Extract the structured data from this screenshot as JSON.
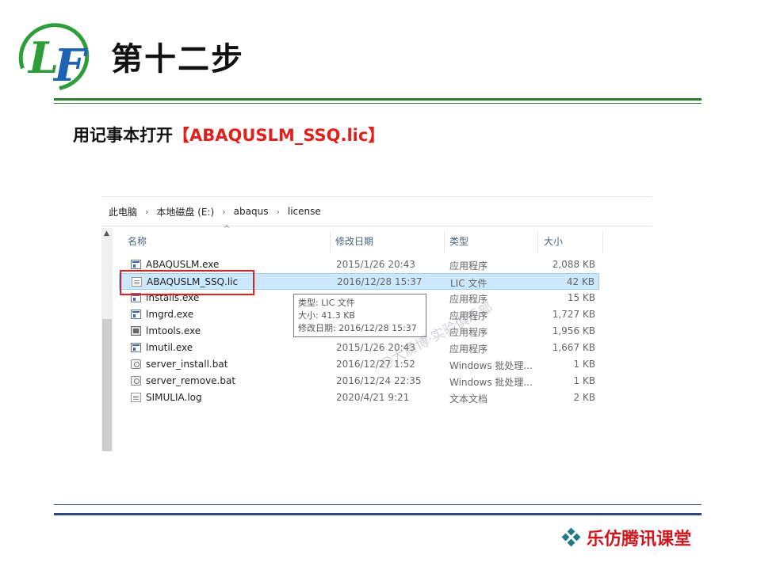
{
  "logo": {
    "text": "LF",
    "colors": {
      "L": "#2e9e3a",
      "F": "#1e62b4",
      "ring": "#2e9e3a"
    }
  },
  "slide": {
    "title": "第十二步",
    "instruction_prefix": "用记事本打开",
    "instruction_highlight": "【ABAQUSLM_SSQ.lic】"
  },
  "explorer": {
    "breadcrumb": [
      "此电脑",
      "本地磁盘 (E:)",
      "abaqus",
      "license"
    ],
    "columns": {
      "name": "名称",
      "date": "修改日期",
      "type": "类型",
      "size": "大小"
    },
    "files": [
      {
        "name": "ABAQUSLM.exe",
        "date": "2015/1/26 20:43",
        "type": "应用程序",
        "size": "2,088 KB",
        "icon": "exe-icon"
      },
      {
        "name": "ABAQUSLM_SSQ.lic",
        "date": "2016/12/28 15:37",
        "type": "LIC 文件",
        "size": "42 KB",
        "icon": "text-file-icon",
        "selected": true
      },
      {
        "name": "installs.exe",
        "date": "",
        "type": "应用程序",
        "size": "15 KB",
        "icon": "exe-icon"
      },
      {
        "name": "lmgrd.exe",
        "date": "",
        "type": "应用程序",
        "size": "1,727 KB",
        "icon": "exe-icon"
      },
      {
        "name": "lmtools.exe",
        "date": "",
        "type": "应用程序",
        "size": "1,956 KB",
        "icon": "tool-icon"
      },
      {
        "name": "lmutil.exe",
        "date": "2015/1/26 20:43",
        "type": "应用程序",
        "size": "1,667 KB",
        "icon": "exe-icon"
      },
      {
        "name": "server_install.bat",
        "date": "2016/12/27 1:52",
        "type": "Windows 批处理...",
        "size": "1 KB",
        "icon": "batch-file-icon"
      },
      {
        "name": "server_remove.bat",
        "date": "2016/12/24 22:35",
        "type": "Windows 批处理...",
        "size": "1 KB",
        "icon": "batch-file-icon"
      },
      {
        "name": "SIMULIA.log",
        "date": "2020/4/21 9:21",
        "type": "文本文档",
        "size": "2 KB",
        "icon": "text-file-icon"
      }
    ],
    "tooltip": [
      "类型: LIC 文件",
      "大小: 41.3 KB",
      "修改日期: 2016/12/28 15:37"
    ]
  },
  "watermark": "@大质博·实验俱乐部",
  "footer": {
    "brand": "乐仿腾讯课堂",
    "brand_color": "#d0151c",
    "icon_color": "#1f7a8a"
  }
}
